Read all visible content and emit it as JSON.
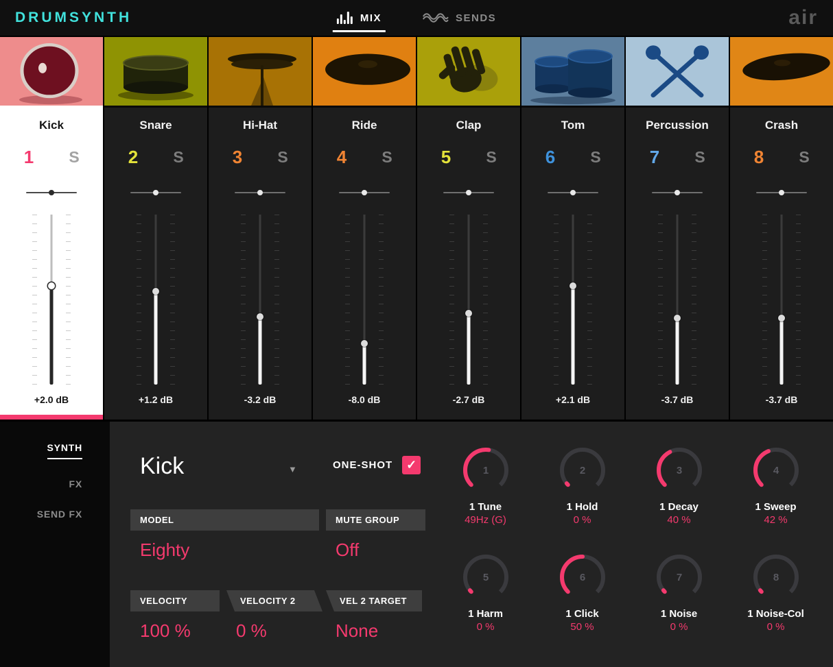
{
  "colors": {
    "accent": "#f43a6e",
    "logo_color": "#41e1dc"
  },
  "icons": {
    "check": "✓",
    "dropdown_arrow": "▼"
  },
  "header": {
    "logo": "DRUMSYNTH",
    "brand": "air",
    "tabs": [
      {
        "label": "MIX",
        "active": true
      },
      {
        "label": "SENDS",
        "active": false
      }
    ]
  },
  "channels": [
    {
      "name": "Kick",
      "number": "1",
      "number_color": "#f43a6e",
      "solo": "S",
      "db": "+2.0 dB",
      "selected": true,
      "thumb": "kick",
      "thumb_bg": "#ee8c8c",
      "fader_percent": 42,
      "pan_percent": 50
    },
    {
      "name": "Snare",
      "number": "2",
      "number_color": "#e3e23a",
      "solo": "S",
      "db": "+1.2 dB",
      "selected": false,
      "thumb": "snare",
      "thumb_bg": "#8f9303",
      "fader_percent": 45,
      "pan_percent": 50
    },
    {
      "name": "Hi-Hat",
      "number": "3",
      "number_color": "#f08433",
      "solo": "S",
      "db": "-3.2 dB",
      "selected": false,
      "thumb": "hihat",
      "thumb_bg": "#a87205",
      "fader_percent": 60,
      "pan_percent": 50
    },
    {
      "name": "Ride",
      "number": "4",
      "number_color": "#f08433",
      "solo": "S",
      "db": "-8.0 dB",
      "selected": false,
      "thumb": "ride",
      "thumb_bg": "#e08011",
      "fader_percent": 76,
      "pan_percent": 50
    },
    {
      "name": "Clap",
      "number": "5",
      "number_color": "#e3e23a",
      "solo": "S",
      "db": "-2.7 dB",
      "selected": false,
      "thumb": "clap",
      "thumb_bg": "#aaa00a",
      "fader_percent": 58,
      "pan_percent": 50
    },
    {
      "name": "Tom",
      "number": "6",
      "number_color": "#3e92dc",
      "solo": "S",
      "db": "+2.1 dB",
      "selected": false,
      "thumb": "tom",
      "thumb_bg": "#5d7f9e",
      "fader_percent": 42,
      "pan_percent": 50
    },
    {
      "name": "Percussion",
      "number": "7",
      "number_color": "#62a8e8",
      "solo": "S",
      "db": "-3.7 dB",
      "selected": false,
      "thumb": "percussion",
      "thumb_bg": "#aac5d9",
      "fader_percent": 61,
      "pan_percent": 50
    },
    {
      "name": "Crash",
      "number": "8",
      "number_color": "#f08433",
      "solo": "S",
      "db": "-3.7 dB",
      "selected": false,
      "thumb": "crash",
      "thumb_bg": "#e08616",
      "fader_percent": 61,
      "pan_percent": 50
    }
  ],
  "sidebar": {
    "items": [
      {
        "label": "SYNTH",
        "active": true
      },
      {
        "label": "FX",
        "active": false
      },
      {
        "label": "SEND FX",
        "active": false
      }
    ]
  },
  "editor": {
    "title": "Kick",
    "oneshot_label": "ONE-SHOT",
    "oneshot_checked": true,
    "fields": [
      {
        "label": "MODEL",
        "value": "Eighty"
      },
      {
        "label": "MUTE GROUP",
        "value": "Off"
      },
      {
        "label": "VELOCITY",
        "value": "100 %"
      },
      {
        "label": "VELOCITY 2",
        "value": "0 %"
      },
      {
        "label": "VEL 2 TARGET",
        "value": "None"
      }
    ],
    "knobs": [
      {
        "num": "1",
        "label": "1 Tune",
        "value": "49Hz (G)",
        "percent": 53
      },
      {
        "num": "2",
        "label": "1 Hold",
        "value": "0 %",
        "percent": 2
      },
      {
        "num": "3",
        "label": "1 Decay",
        "value": "40 %",
        "percent": 40
      },
      {
        "num": "4",
        "label": "1 Sweep",
        "value": "42 %",
        "percent": 42
      },
      {
        "num": "5",
        "label": "1 Harm",
        "value": "0 %",
        "percent": 2
      },
      {
        "num": "6",
        "label": "1 Click",
        "value": "50 %",
        "percent": 50
      },
      {
        "num": "7",
        "label": "1 Noise",
        "value": "0 %",
        "percent": 2
      },
      {
        "num": "8",
        "label": "1 Noise-Col",
        "value": "0 %",
        "percent": 2
      }
    ]
  }
}
